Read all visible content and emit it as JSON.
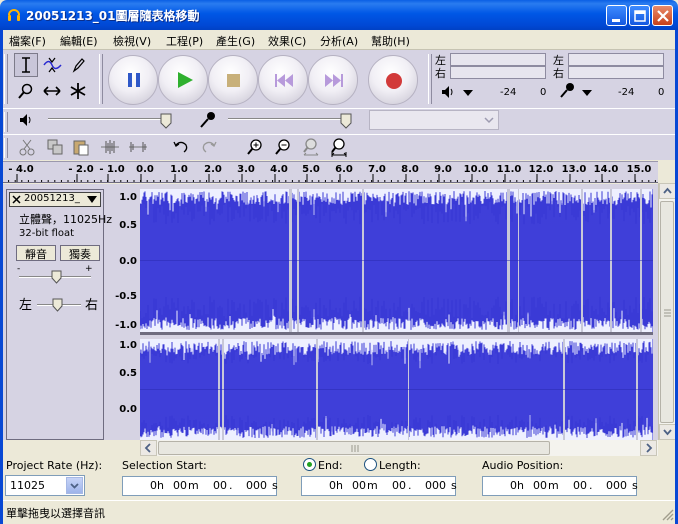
{
  "window": {
    "title": "20051213_01圖層隨表格移動"
  },
  "menu": [
    "檔案(F)",
    "編輯(E)",
    "檢視(V)",
    "工程(P)",
    "產生(G)",
    "效果(C)",
    "分析(A)",
    "幫助(H)"
  ],
  "meters": {
    "output_left": "左",
    "output_right": "右",
    "input_left": "左",
    "input_right": "右",
    "scale_out_a": "-24",
    "scale_out_b": "0",
    "scale_in_a": "-24",
    "scale_in_b": "0"
  },
  "ruler": {
    "ticks": [
      "- 4.0",
      "- 2.0",
      "- 1.0",
      "0.0",
      "1.0",
      "2.0",
      "3.0",
      "4.0",
      "5.0",
      "6.0",
      "7.0",
      "8.0",
      "9.0",
      "10.0",
      "11.0",
      "12.0",
      "13.0",
      "14.0",
      "15.0"
    ]
  },
  "track": {
    "name": "20051213_",
    "format_line1": "立體聲，11025Hz",
    "format_line2": "32-bit float",
    "mute_label": "靜音",
    "solo_label": "獨奏",
    "pan_left": "左",
    "pan_right": "右",
    "gain_minus": "-",
    "gain_plus": "+",
    "scale_top": [
      "1.0",
      "0.5",
      "0.0",
      "-0.5",
      "-1.0"
    ],
    "scale_bottom": [
      "1.0",
      "0.5",
      "0.0"
    ]
  },
  "selection": {
    "project_rate_label": "Project Rate (Hz):",
    "project_rate_value": "11025",
    "selection_start_label": "Selection Start:",
    "end_label": "End:",
    "length_label": "Length:",
    "audio_position_label": "Audio Position:",
    "end_selected": true,
    "start": {
      "h": "0",
      "m": "00",
      "s": "00",
      "ms": "000"
    },
    "end": {
      "h": "0",
      "m": "00",
      "s": "00",
      "ms": "000"
    },
    "position": {
      "h": "0",
      "m": "00",
      "s": "00",
      "ms": "000"
    },
    "unit_h": "h",
    "unit_m": "m",
    "unit_s": "s",
    "dot": "."
  },
  "status": {
    "text": "單擊拖曳以選擇音訊"
  },
  "colors": {
    "waveform": "#3a3ad6",
    "waveform_bg": "#eef0ff",
    "toolbar_bg": "#d6d3e3",
    "titlebar": "#0054e3"
  }
}
